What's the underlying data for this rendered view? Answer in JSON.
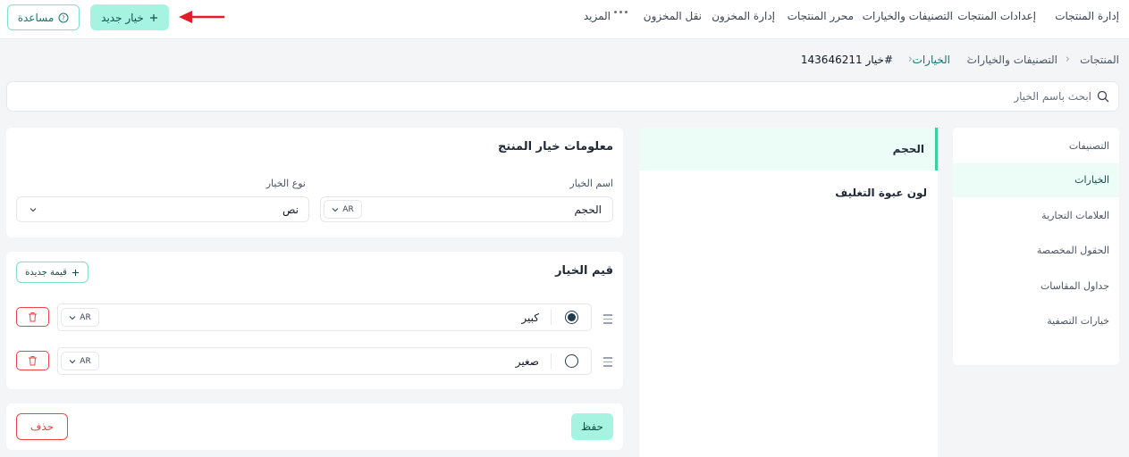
{
  "topbar": {
    "help_label": "مساعدة",
    "new_option_label": "خيار جديد",
    "nav": [
      {
        "label": "إدارة المنتجات"
      },
      {
        "label": "إعدادات المنتجات"
      },
      {
        "label": "التصنيفات والخيارات"
      },
      {
        "label": "محرر المنتجات"
      },
      {
        "label": "إدارة المخزون"
      },
      {
        "label": "نقل المخزون"
      },
      {
        "label": "المزيد"
      }
    ]
  },
  "breadcrumb": [
    "المنتجات",
    "التصنيفات والخيارات",
    "الخيارات",
    "خيار 143646211#"
  ],
  "search": {
    "placeholder": "ابحث باسم الخيار"
  },
  "sidebar": {
    "items": [
      {
        "label": "التصنيفات"
      },
      {
        "label": "الخيارات"
      },
      {
        "label": "العلامات التجارية"
      },
      {
        "label": "الحقول المخصصة"
      },
      {
        "label": "جداول المقاسات"
      },
      {
        "label": "خيارات التصفية"
      }
    ],
    "active_index": 1
  },
  "options_list": [
    {
      "label": "الحجم"
    },
    {
      "label": "لون عبوة التغليف"
    }
  ],
  "info_card": {
    "title": "معلومات خيار المنتج",
    "name_label": "اسم الخيار",
    "name_value": "الحجم",
    "name_lang": "AR",
    "type_label": "نوع الخيار",
    "type_value": "نص"
  },
  "values_card": {
    "title": "قيم الخيار",
    "new_value_label": "قيمة جديدة",
    "rows": [
      {
        "value": "كبير",
        "lang": "AR",
        "default": true
      },
      {
        "value": "صغير",
        "lang": "AR",
        "default": false
      }
    ]
  },
  "actions": {
    "save_label": "حفظ",
    "delete_label": "حذف"
  },
  "colors": {
    "accent": "#a7f3e2",
    "accent_border": "#7fe0c9",
    "danger": "#ef4444",
    "annotation_arrow": "#e11d2a"
  }
}
